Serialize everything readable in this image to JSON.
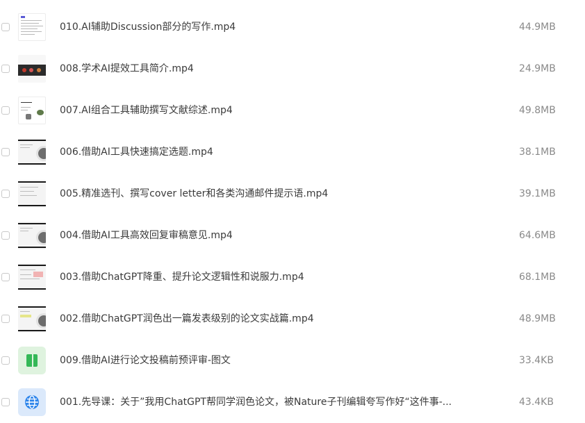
{
  "files": [
    {
      "name": "010.AI辅助Discussion部分的写作.mp4",
      "size": "44.9MB",
      "thumb": "doc-page-thumbnail"
    },
    {
      "name": "008.学术AI提效工具简介.mp4",
      "size": "24.9MB",
      "thumb": "slides-thumbnail"
    },
    {
      "name": "007.AI组合工具辅助撰写文献综述.mp4",
      "size": "49.8MB",
      "thumb": "diagram-thumbnail"
    },
    {
      "name": "006.借助AI工具快速搞定选题.mp4",
      "size": "38.1MB",
      "thumb": "video-thumbnail"
    },
    {
      "name": "005.精准选刊、撰写cover letter和各类沟通邮件提示语.mp4",
      "size": "39.1MB",
      "thumb": "video-thumbnail"
    },
    {
      "name": "004.借助AI工具高效回复审稿意见.mp4",
      "size": "64.6MB",
      "thumb": "video-thumbnail"
    },
    {
      "name": "003.借助ChatGPT降重、提升论文逻辑性和说服力.mp4",
      "size": "68.1MB",
      "thumb": "video-thumbnail"
    },
    {
      "name": "002.借助ChatGPT润色出一篇发表级别的论文实战篇.mp4",
      "size": "48.9MB",
      "thumb": "video-thumbnail"
    },
    {
      "name": "009.借助AI进行论文投稿前预评审-图文",
      "size": "33.4KB",
      "thumb": "document-icon"
    },
    {
      "name": "001.先导课：关于”我用ChatGPT帮同学润色论文，被Nature子刊编辑夸写作好“这件事-...",
      "size": "43.4KB",
      "thumb": "web-globe-icon"
    }
  ],
  "colors": {
    "filename": "#3a3a3a",
    "size": "#8a8a8a",
    "doc_icon": "#34b857",
    "web_icon": "#2f86eb"
  }
}
